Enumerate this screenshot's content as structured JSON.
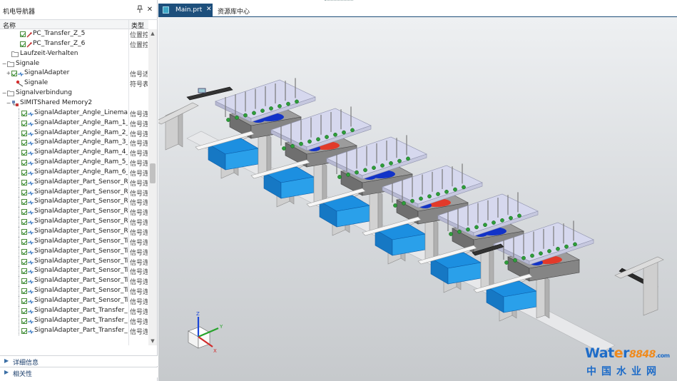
{
  "navigator": {
    "title": "机电导航器",
    "pin_icon": "pin-icon",
    "close_label": "✕",
    "column_name": "名称",
    "column_type": "类型",
    "rows": [
      {
        "label": "PC_Transfer_Z_5",
        "type": "位置控",
        "indent": 3,
        "icon": "check-position-icon",
        "expander": ""
      },
      {
        "label": "PC_Transfer_Z_6",
        "type": "位置控",
        "indent": 3,
        "icon": "check-position-icon",
        "expander": ""
      },
      {
        "label": "Laufzeit-Verhalten",
        "type": "",
        "indent": 1,
        "icon": "folder-icon",
        "expander": ""
      },
      {
        "label": "Signale",
        "type": "",
        "indent": 0,
        "icon": "folder-icon",
        "expander": "−"
      },
      {
        "label": "SignalAdapter",
        "type": "信号适",
        "indent": 1,
        "icon": "check-signal-adapter-icon",
        "expander": "+"
      },
      {
        "label": "Signale",
        "type": "符号表",
        "indent": 2,
        "icon": "signal-icon",
        "expander": ""
      },
      {
        "label": "Signalverbindung",
        "type": "",
        "indent": 0,
        "icon": "folder-icon",
        "expander": "−"
      },
      {
        "label": "SIMITShared Memory2",
        "type": "",
        "indent": 1,
        "icon": "connection-icon",
        "expander": "−"
      },
      {
        "label": "SignalAdapter_Angle_Linemaste...",
        "type": "信号连",
        "indent": 2,
        "icon": "check-signal-icon",
        "expander": ""
      },
      {
        "label": "SignalAdapter_Angle_Ram_1_A...",
        "type": "信号连",
        "indent": 2,
        "icon": "check-signal-icon",
        "expander": ""
      },
      {
        "label": "SignalAdapter_Angle_Ram_2_A...",
        "type": "信号连",
        "indent": 2,
        "icon": "check-signal-icon",
        "expander": ""
      },
      {
        "label": "SignalAdapter_Angle_Ram_3_A...",
        "type": "信号连",
        "indent": 2,
        "icon": "check-signal-icon",
        "expander": ""
      },
      {
        "label": "SignalAdapter_Angle_Ram_4_A...",
        "type": "信号连",
        "indent": 2,
        "icon": "check-signal-icon",
        "expander": ""
      },
      {
        "label": "SignalAdapter_Angle_Ram_5_A...",
        "type": "信号连",
        "indent": 2,
        "icon": "check-signal-icon",
        "expander": ""
      },
      {
        "label": "SignalAdapter_Angle_Ram_6_A...",
        "type": "信号连",
        "indent": 2,
        "icon": "check-signal-icon",
        "expander": ""
      },
      {
        "label": "SignalAdapter_Part_Sensor_Ra...",
        "type": "信号连",
        "indent": 2,
        "icon": "check-signal-icon",
        "expander": ""
      },
      {
        "label": "SignalAdapter_Part_Sensor_Ra...",
        "type": "信号连",
        "indent": 2,
        "icon": "check-signal-icon",
        "expander": ""
      },
      {
        "label": "SignalAdapter_Part_Sensor_Ra...",
        "type": "信号连",
        "indent": 2,
        "icon": "check-signal-icon",
        "expander": ""
      },
      {
        "label": "SignalAdapter_Part_Sensor_Ra...",
        "type": "信号连",
        "indent": 2,
        "icon": "check-signal-icon",
        "expander": ""
      },
      {
        "label": "SignalAdapter_Part_Sensor_Ra...",
        "type": "信号连",
        "indent": 2,
        "icon": "check-signal-icon",
        "expander": ""
      },
      {
        "label": "SignalAdapter_Part_Sensor_Ra...",
        "type": "信号连",
        "indent": 2,
        "icon": "check-signal-icon",
        "expander": ""
      },
      {
        "label": "SignalAdapter_Part_Sensor_Tran...",
        "type": "信号连",
        "indent": 2,
        "icon": "check-signal-icon",
        "expander": ""
      },
      {
        "label": "SignalAdapter_Part_Sensor_Tran...",
        "type": "信号连",
        "indent": 2,
        "icon": "check-signal-icon",
        "expander": ""
      },
      {
        "label": "SignalAdapter_Part_Sensor_Tran...",
        "type": "信号连",
        "indent": 2,
        "icon": "check-signal-icon",
        "expander": ""
      },
      {
        "label": "SignalAdapter_Part_Sensor_Tran...",
        "type": "信号连",
        "indent": 2,
        "icon": "check-signal-icon",
        "expander": ""
      },
      {
        "label": "SignalAdapter_Part_Sensor_Tran...",
        "type": "信号连",
        "indent": 2,
        "icon": "check-signal-icon",
        "expander": ""
      },
      {
        "label": "SignalAdapter_Part_Sensor_Tran...",
        "type": "信号连",
        "indent": 2,
        "icon": "check-signal-icon",
        "expander": ""
      },
      {
        "label": "SignalAdapter_Part_Sensor_Tran...",
        "type": "信号连",
        "indent": 2,
        "icon": "check-signal-icon",
        "expander": ""
      },
      {
        "label": "SignalAdapter_Part_Transfer_Pic...",
        "type": "信号连",
        "indent": 2,
        "icon": "check-signal-icon",
        "expander": ""
      },
      {
        "label": "SignalAdapter_Part_Transfer_Pic...",
        "type": "信号连",
        "indent": 2,
        "icon": "check-signal-icon",
        "expander": ""
      },
      {
        "label": "SignalAdapter_Part_Transfer_Pic...",
        "type": "信号连",
        "indent": 2,
        "icon": "check-signal-icon",
        "expander": ""
      }
    ],
    "sections": [
      {
        "label": "详细信息"
      },
      {
        "label": "相关性"
      }
    ]
  },
  "tabs": [
    {
      "label": "Main.prt",
      "close": "✕",
      "active": true
    },
    {
      "label": "资源库中心",
      "active": false
    }
  ],
  "viewport": {
    "triad_labels": {
      "z": "Z",
      "y": "Y",
      "x": "X"
    },
    "colors": {
      "frame": "#cfcfcf",
      "blue_base": "#1c8fe0",
      "dark_blue": "#1233c8",
      "deck": "#d6d8ee",
      "green_sensor": "#2e9e3a",
      "red_part": "#e23a2a"
    }
  },
  "watermark": {
    "brand_a": "Wat",
    "brand_o": "e",
    "brand_b": "r",
    "number": "8848",
    "suffix": ".com",
    "chinese": "中国水业网"
  }
}
